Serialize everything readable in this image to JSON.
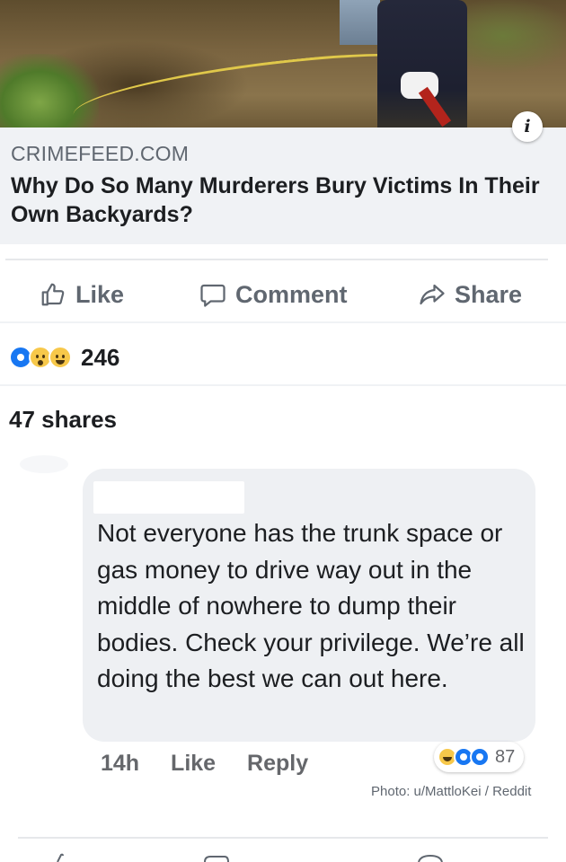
{
  "link_preview": {
    "domain": "CRIMEFEED.COM",
    "title": "Why Do So Many Murderers Bury Victims In Their Own Backyards?",
    "info_icon": "info-icon",
    "info_glyph": "i"
  },
  "post_actions": [
    {
      "label": "Like",
      "icon": "thumbs-up-icon"
    },
    {
      "label": "Comment",
      "icon": "comment-icon"
    },
    {
      "label": "Share",
      "icon": "share-icon"
    }
  ],
  "reactions": {
    "types": [
      "like",
      "wow",
      "haha"
    ],
    "count": "246"
  },
  "shares_text": "47 shares",
  "comment": {
    "author": "",
    "text": "Not everyone has the trunk space or gas money to drive way out in the middle of nowhere to dump their bodies. Check your privilege. We’re all doing the best we can out here.",
    "time": "14h",
    "like_label": "Like",
    "reply_label": "Reply",
    "reaction_types": [
      "haha",
      "like",
      "like"
    ],
    "reaction_count": "87"
  },
  "photo_credit": "Photo: u/MattloKei / Reddit",
  "colors": {
    "link_bg": "#f0f2f5",
    "bubble_bg": "#eef0f3",
    "muted_text": "#606770",
    "like_blue": "#1877f2",
    "emoji_yellow": "#f7c84a"
  }
}
